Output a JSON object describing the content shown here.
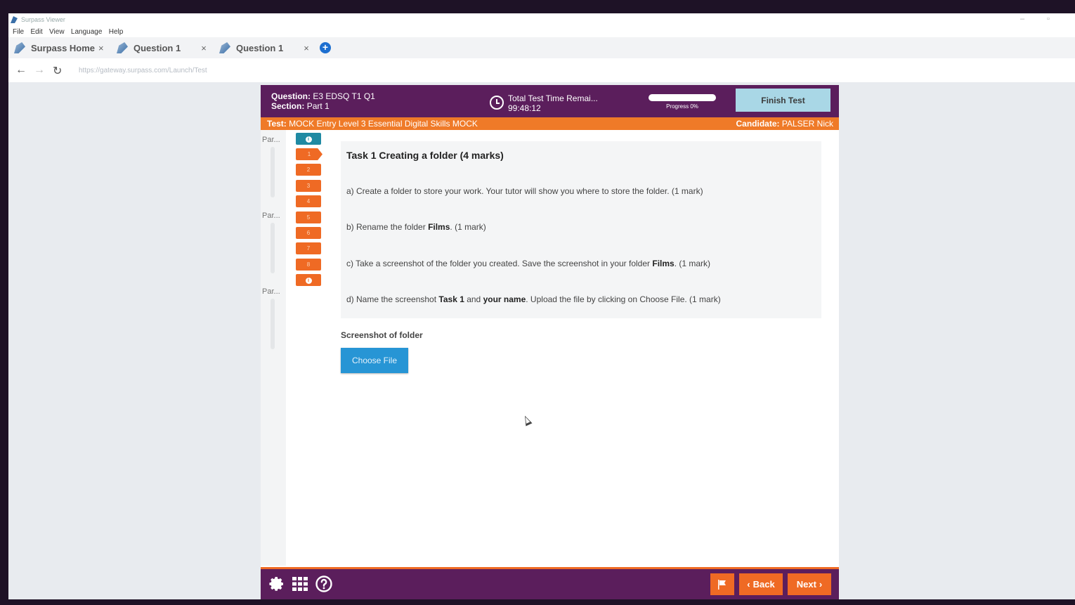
{
  "window": {
    "title": "Surpass Viewer"
  },
  "menu": [
    "File",
    "Edit",
    "View",
    "Language",
    "Help"
  ],
  "tabs": [
    {
      "label": "Surpass Home",
      "close": "×"
    },
    {
      "label": "Question 1",
      "close": "×"
    },
    {
      "label": "Question 1",
      "close": "×"
    }
  ],
  "address": {
    "url": "https://gateway.surpass.com/Launch/Test"
  },
  "exam": {
    "question_label": "Question:",
    "question_value": "E3 EDSQ T1 Q1",
    "section_label": "Section:",
    "section_value": "Part 1",
    "timer_label": "Total Test Time Remai...",
    "timer_value": "99:48:12",
    "progress_label": "Progress 0%",
    "progress_fraction": 0,
    "finish_label": "Finish Test",
    "test_label": "Test:",
    "test_value": "MOCK Entry Level 3 Essential Digital Skills MOCK",
    "candidate_label": "Candidate:",
    "candidate_value": "PALSER Nick"
  },
  "sections": [
    "Par...",
    "Par...",
    "Par..."
  ],
  "question_nav": [
    "i",
    "1",
    "2",
    "3",
    "4",
    "5",
    "6",
    "7",
    "8",
    "i"
  ],
  "task": {
    "title": "Task 1 Creating a folder (4 marks)",
    "a": "a) Create a folder to store your work. Your tutor will show you where to store the folder. (1 mark)",
    "b_pre": "b) Rename the folder ",
    "b_bold": "Films",
    "b_post": ". (1 mark)",
    "c_pre": "c) Take a screenshot of the folder you created. Save the screenshot in your folder ",
    "c_bold": "Films",
    "c_post": ". (1 mark)",
    "d_pre": "d) Name the screenshot ",
    "d_bold1": "Task 1",
    "d_mid": " and ",
    "d_bold2": "your name",
    "d_post": ". Upload the file by clicking on Choose File. (1 mark)"
  },
  "upload": {
    "label": "Screenshot of folder",
    "button": "Choose File"
  },
  "footer": {
    "back": "Back",
    "next": "Next"
  },
  "colors": {
    "purple": "#5b1e5c",
    "orange": "#ef6a24",
    "teal": "#1f8aa3",
    "blue": "#2795d5"
  }
}
